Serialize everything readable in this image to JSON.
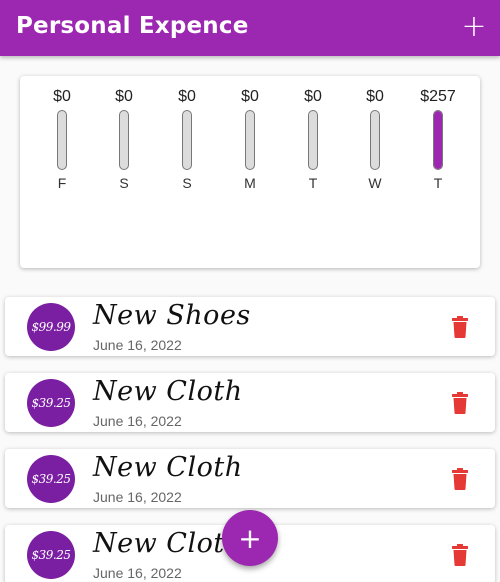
{
  "appbar": {
    "title": "Personal Expence",
    "add_icon": "plus-icon",
    "add_glyph": "+"
  },
  "chart": {
    "bars": [
      {
        "amount": "$0",
        "day": "F",
        "fraction": 0
      },
      {
        "amount": "$0",
        "day": "S",
        "fraction": 0
      },
      {
        "amount": "$0",
        "day": "S",
        "fraction": 0
      },
      {
        "amount": "$0",
        "day": "M",
        "fraction": 0
      },
      {
        "amount": "$0",
        "day": "T",
        "fraction": 0
      },
      {
        "amount": "$0",
        "day": "W",
        "fraction": 0
      },
      {
        "amount": "$257",
        "day": "T",
        "fraction": 1
      }
    ]
  },
  "transactions": [
    {
      "price": "$99.99",
      "title": "New Shoes",
      "date": "June 16, 2022"
    },
    {
      "price": "$39.25",
      "title": "New Cloth",
      "date": "June 16, 2022"
    },
    {
      "price": "$39.25",
      "title": "New Cloth",
      "date": "June 16, 2022"
    },
    {
      "price": "$39.25",
      "title": "New Cloth",
      "date": "June 16, 2022"
    }
  ],
  "fab": {
    "glyph": "+",
    "icon": "plus-icon"
  },
  "colors": {
    "primary": "#9c27b0",
    "avatar": "#7b1fa2",
    "delete": "#e53935",
    "track": "#dcdcdc"
  }
}
